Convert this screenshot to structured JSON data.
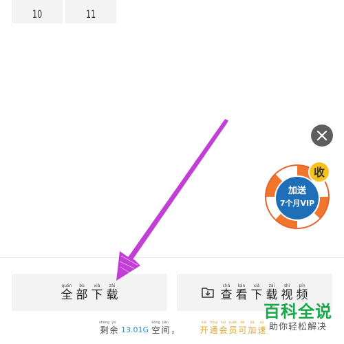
{
  "episodes": [
    {
      "label": "10"
    },
    {
      "label": "11"
    }
  ],
  "promo": {
    "badge": "收",
    "line1": "加送",
    "line2": "7个月VIP"
  },
  "buttons": {
    "download_all": [
      {
        "py": "quán",
        "hz": "全"
      },
      {
        "py": "bù",
        "hz": "部"
      },
      {
        "py": "xià",
        "hz": "下"
      },
      {
        "py": "zài",
        "hz": "载"
      }
    ],
    "view_videos": [
      {
        "py": "chá",
        "hz": "查"
      },
      {
        "py": "kàn",
        "hz": "看"
      },
      {
        "py": "xià",
        "hz": "下"
      },
      {
        "py": "zài",
        "hz": "载"
      },
      {
        "py": "shì",
        "hz": "视"
      },
      {
        "py": "pín",
        "hz": "频"
      }
    ]
  },
  "footer": {
    "prefix": [
      {
        "py": "shèng",
        "hz": "剩"
      },
      {
        "py": "yú",
        "hz": "余"
      }
    ],
    "space_value": "13.01G",
    "suffix": [
      {
        "py": "kōng",
        "hz": "空"
      },
      {
        "py": "jiān",
        "hz": "间"
      },
      {
        "py": "",
        "hz": "，"
      }
    ],
    "vip_link": [
      {
        "py": "kāi",
        "hz": "开"
      },
      {
        "py": "tōng",
        "hz": "通"
      },
      {
        "py": "huì",
        "hz": "会"
      },
      {
        "py": "yuán",
        "hz": "员"
      },
      {
        "py": "kě",
        "hz": "可"
      },
      {
        "py": "jiā",
        "hz": "加"
      },
      {
        "py": "sù",
        "hz": "速"
      }
    ]
  },
  "watermark": {
    "title": "百科全说",
    "subtitle": "助你轻松解决"
  },
  "colors": {
    "arrow": "#c23fd6",
    "accent_blue": "#2a8cc7",
    "accent_gold": "#e0a62a",
    "watermark_green": "#18a84a"
  }
}
